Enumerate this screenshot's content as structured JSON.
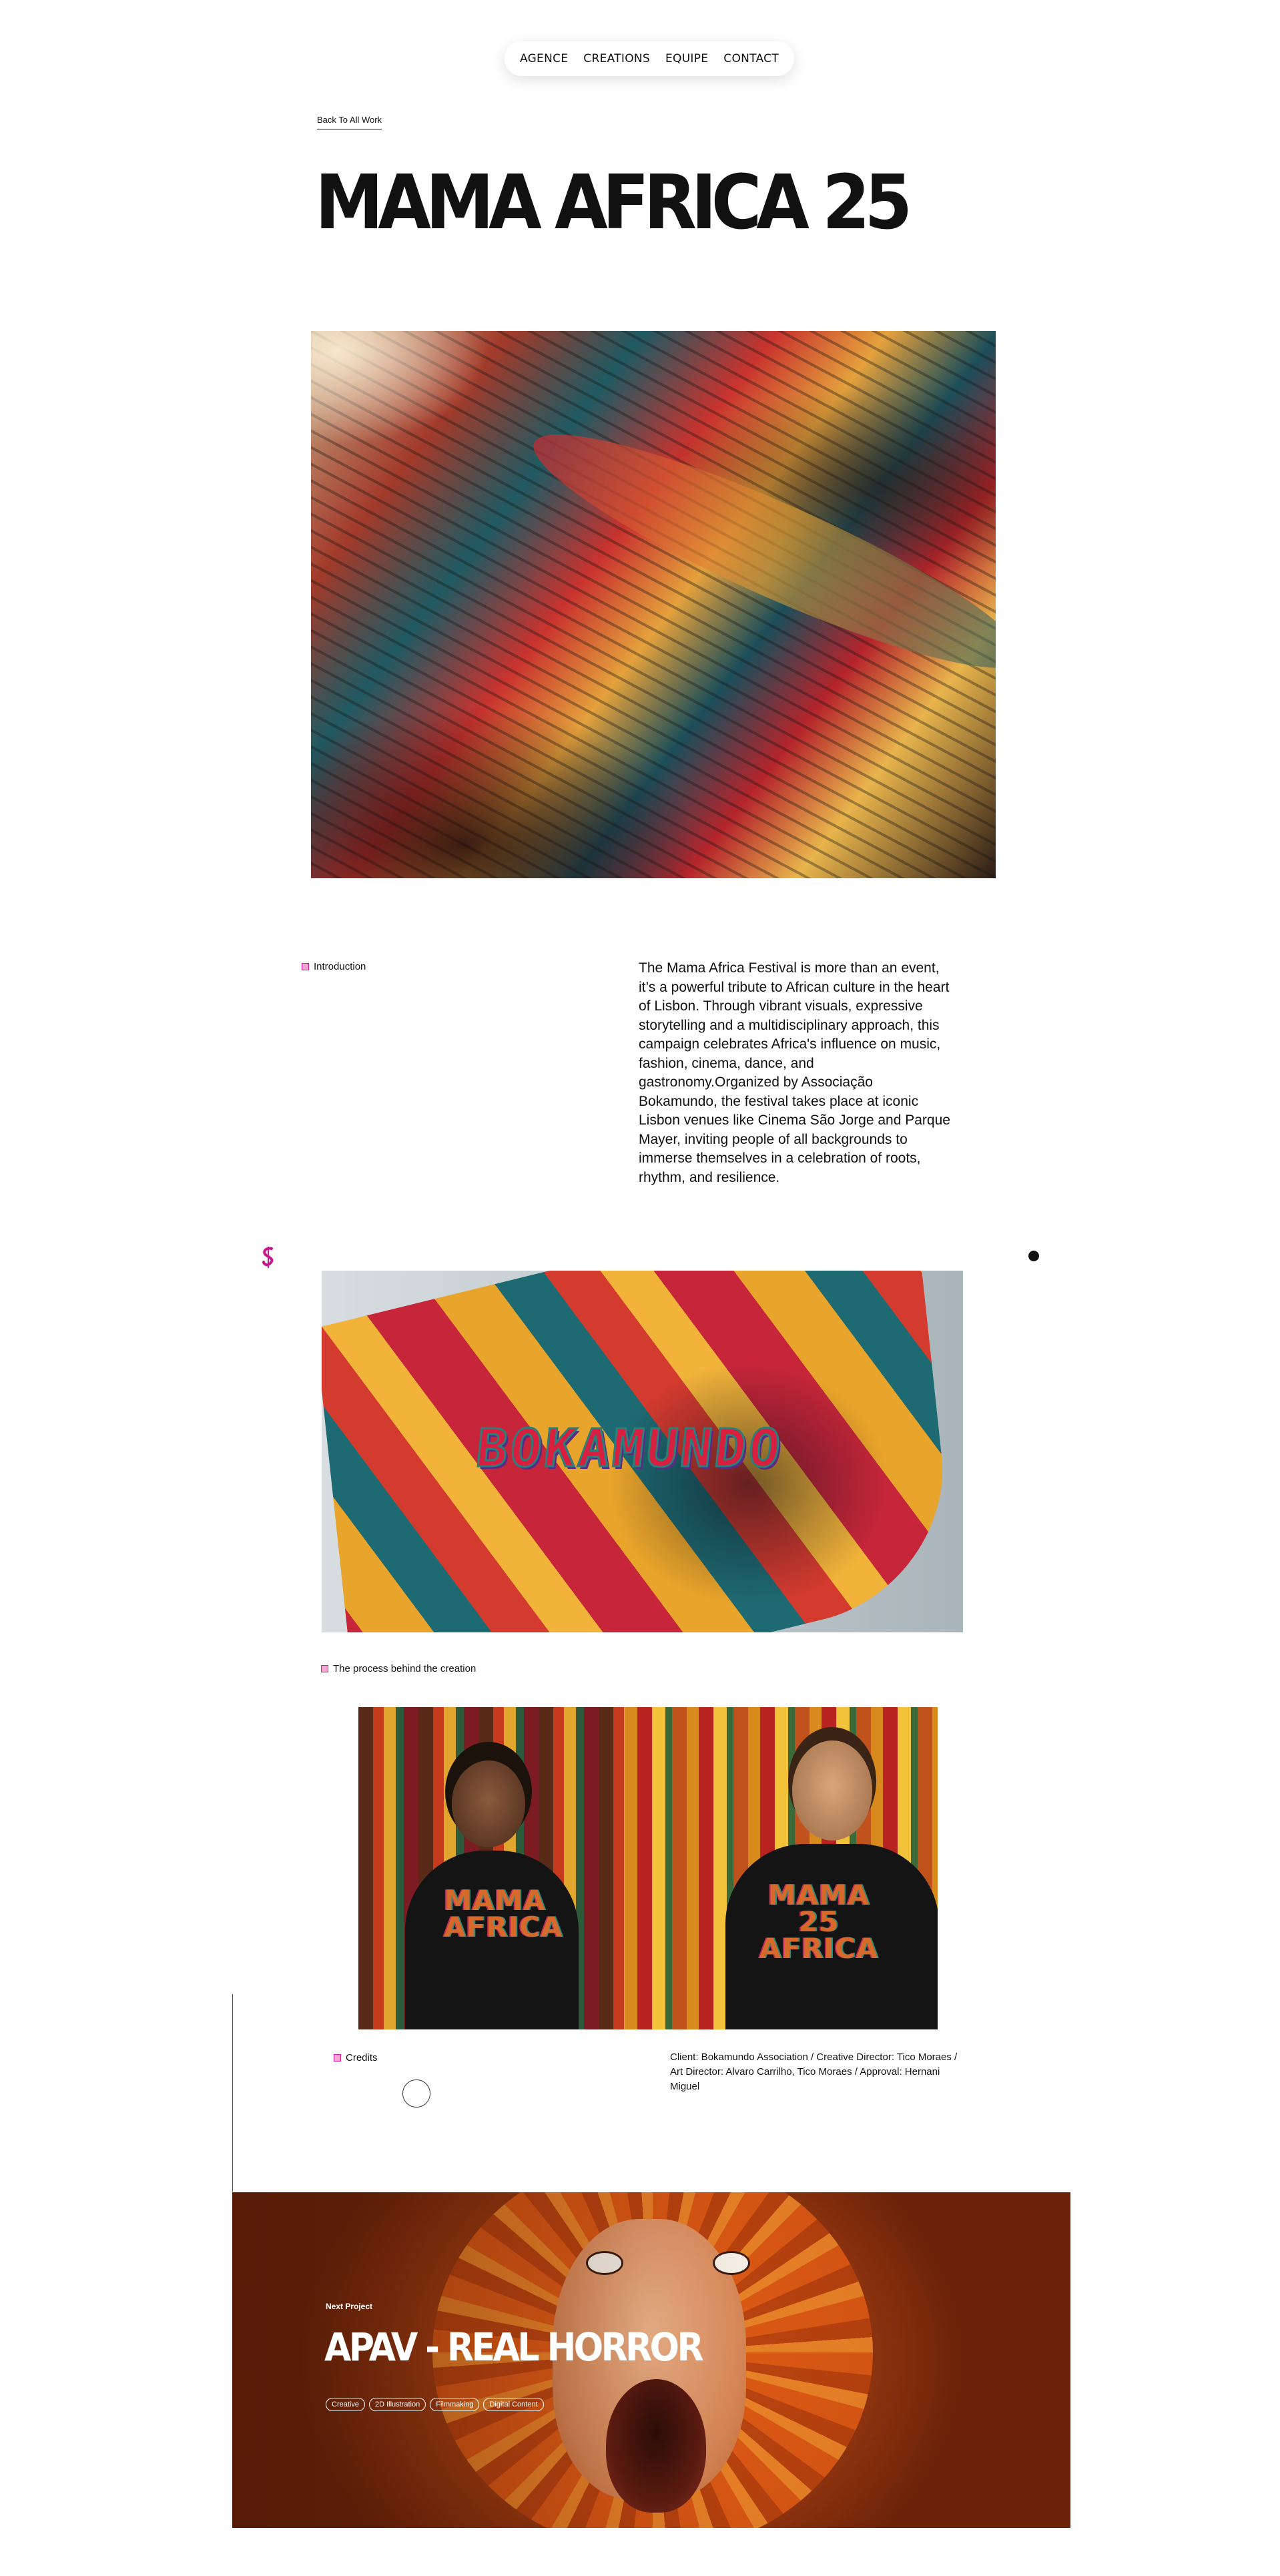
{
  "nav": {
    "items": [
      {
        "label": "AGENCE"
      },
      {
        "label": "CREATIONS"
      },
      {
        "label": "EQUIPE"
      },
      {
        "label": "CONTACT"
      }
    ]
  },
  "back_link": "Back To All Work",
  "title": "MAMA AFRICA 25",
  "intro": {
    "label": "Introduction",
    "text": "The Mama Africa Festival is more than an event, it’s a powerful tribute to African culture in the heart of Lisbon. Through vibrant visuals, expressive storytelling and a multidisciplinary approach, this campaign celebrates Africa's influence on music, fashion, cinema, dance, and gastronomy.Organized by Associação Bokamundo, the festival takes place at iconic Lisbon venues like Cinema São Jorge and Parque Mayer, inviting people of all backgrounds to immerse themselves in a celebration of roots, rhythm, and resilience."
  },
  "flag_image": {
    "text": "BOKAMUNDO"
  },
  "process": {
    "label": "The process behind the creation"
  },
  "shirts_image": {
    "shirt_left": "MAMA AFRICA",
    "shirt_right": "MAMA 25 AFRICA"
  },
  "credits": {
    "label": "Credits",
    "text": "Client: Bokamundo Association / Creative Director: Tico Moraes / Art Director: Alvaro Carrilho, Tico Moraes / Approval: Hernani Miguel"
  },
  "next_project": {
    "label": "Next Project",
    "title": "APAV - REAL HORROR",
    "tags": [
      "Creative",
      "2D Illustration",
      "Filmmaking",
      "Digital Content"
    ]
  },
  "colors": {
    "accent": "#d1168f",
    "text": "#111111",
    "background": "#ffffff"
  }
}
